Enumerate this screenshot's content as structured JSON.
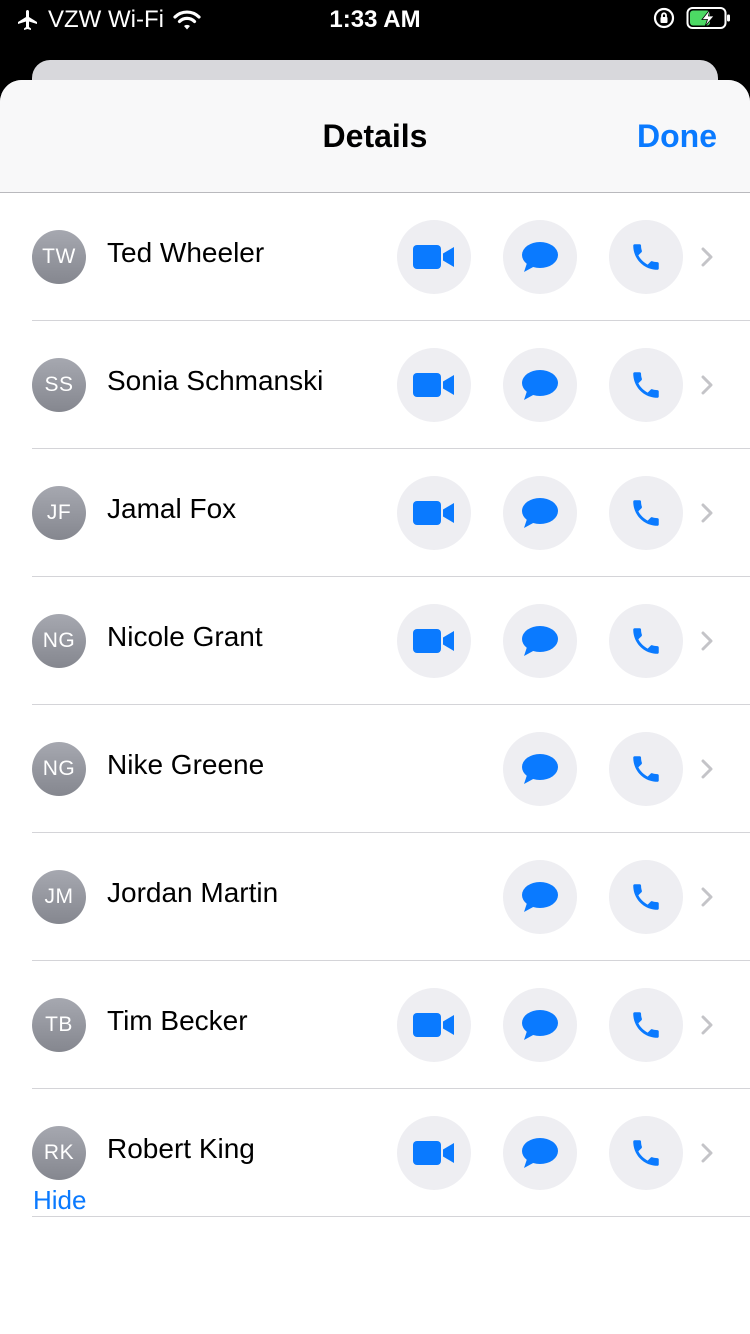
{
  "status_bar": {
    "carrier": "VZW Wi-Fi",
    "time": "1:33 AM",
    "icons": [
      "airplane-icon",
      "wifi-icon",
      "orientation-lock-icon",
      "battery-charging-icon"
    ]
  },
  "sheet": {
    "title": "Details",
    "done_label": "Done"
  },
  "contacts": [
    {
      "initials": "TW",
      "name": "Ted Wheeler",
      "video": true
    },
    {
      "initials": "SS",
      "name": "Sonia Schmanski",
      "video": true
    },
    {
      "initials": "JF",
      "name": "Jamal Fox",
      "video": true
    },
    {
      "initials": "NG",
      "name": "Nicole Grant",
      "video": true
    },
    {
      "initials": "NG",
      "name": "Nike Greene",
      "video": false
    },
    {
      "initials": "JM",
      "name": "Jordan Martin",
      "video": false
    },
    {
      "initials": "TB",
      "name": "Tim Becker",
      "video": true
    },
    {
      "initials": "RK",
      "name": "Robert King",
      "video": true
    }
  ],
  "footer": {
    "hide_label": "Hide"
  },
  "colors": {
    "accent": "#0a7aff",
    "button_bg": "#eeeef2",
    "avatar": "#95979f"
  }
}
